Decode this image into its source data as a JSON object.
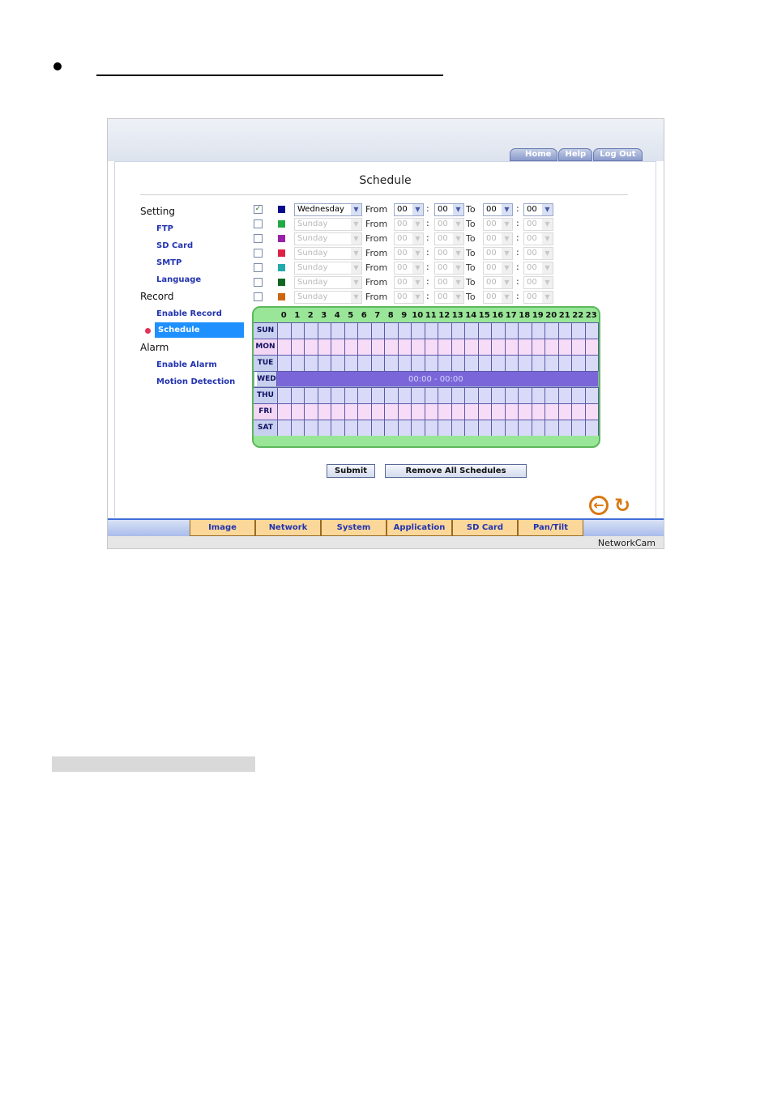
{
  "header": {
    "links": [
      "Home",
      "Help",
      "Log Out"
    ]
  },
  "page_title": "Schedule",
  "menu": {
    "sections": [
      {
        "label": "Setting",
        "items": [
          "FTP",
          "SD Card",
          "SMTP",
          "Language"
        ]
      },
      {
        "label": "Record",
        "items": [
          "Enable Record",
          "Schedule"
        ]
      },
      {
        "label": "Alarm",
        "items": [
          "Enable Alarm",
          "Motion Detection"
        ]
      }
    ],
    "active_item": "Schedule"
  },
  "labels": {
    "from": "From",
    "to": "To",
    "colon": ":"
  },
  "schedule_rows": [
    {
      "checked": true,
      "color": "#0a0a8a",
      "day": "Wednesday",
      "from_h": "00",
      "from_m": "00",
      "to_h": "00",
      "to_m": "00",
      "enabled": true
    },
    {
      "checked": false,
      "color": "#22aa44",
      "day": "Sunday",
      "from_h": "00",
      "from_m": "00",
      "to_h": "00",
      "to_m": "00",
      "enabled": false
    },
    {
      "checked": false,
      "color": "#9a22aa",
      "day": "Sunday",
      "from_h": "00",
      "from_m": "00",
      "to_h": "00",
      "to_m": "00",
      "enabled": false
    },
    {
      "checked": false,
      "color": "#dd2244",
      "day": "Sunday",
      "from_h": "00",
      "from_m": "00",
      "to_h": "00",
      "to_m": "00",
      "enabled": false
    },
    {
      "checked": false,
      "color": "#22aaaa",
      "day": "Sunday",
      "from_h": "00",
      "from_m": "00",
      "to_h": "00",
      "to_m": "00",
      "enabled": false
    },
    {
      "checked": false,
      "color": "#116622",
      "day": "Sunday",
      "from_h": "00",
      "from_m": "00",
      "to_h": "00",
      "to_m": "00",
      "enabled": false
    },
    {
      "checked": false,
      "color": "#cc6611",
      "day": "Sunday",
      "from_h": "00",
      "from_m": "00",
      "to_h": "00",
      "to_m": "00",
      "enabled": false
    }
  ],
  "grid": {
    "hours": [
      "0",
      "1",
      "2",
      "3",
      "4",
      "5",
      "6",
      "7",
      "8",
      "9",
      "10",
      "11",
      "12",
      "13",
      "14",
      "15",
      "16",
      "17",
      "18",
      "19",
      "20",
      "21",
      "22",
      "23"
    ],
    "days": [
      "SUN",
      "MON",
      "TUE",
      "WED",
      "THU",
      "FRI",
      "SAT"
    ],
    "selected_day": "WED",
    "selected_range_text": "00:00 - 00:00"
  },
  "buttons": {
    "submit": "Submit",
    "remove_all": "Remove All Schedules"
  },
  "nav_tabs": [
    "Image",
    "Network",
    "System",
    "Application",
    "SD Card",
    "Pan/Tilt"
  ],
  "footer": {
    "brand": "NetworkCam"
  },
  "icons": {
    "back": "back-arrow-icon",
    "refresh": "refresh-icon"
  },
  "colors": {
    "accent": "#1e90ff",
    "grid_bg": "#99e698",
    "selected_row": "#7a66d8",
    "nav_tab": "#fbd89a"
  }
}
